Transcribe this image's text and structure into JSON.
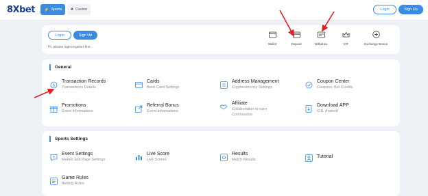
{
  "header": {
    "logo": "8Xbet",
    "tabs": [
      {
        "label": "Sports",
        "icon": "lightning-icon"
      },
      {
        "label": "Casino",
        "icon": "casino-icon"
      }
    ],
    "login_label": "Login",
    "signup_label": "Sign Up"
  },
  "account": {
    "login_label": "Login",
    "signup_label": "Sign Up",
    "hint": "Hi, please login/register first",
    "actions": [
      {
        "label": "Wallet",
        "icon": "wallet-icon"
      },
      {
        "label": "Deposit",
        "icon": "deposit-icon"
      },
      {
        "label": "Withdraw",
        "icon": "withdraw-icon"
      },
      {
        "label": "VIP",
        "icon": "crown-icon"
      },
      {
        "label": "Exchange Bonus",
        "icon": "exchange-icon"
      }
    ]
  },
  "general": {
    "title": "General",
    "items": [
      {
        "title": "Transaction Records",
        "subtitle": "Transactions Details"
      },
      {
        "title": "Cards",
        "subtitle": "Bank Card Settings"
      },
      {
        "title": "Address Management",
        "subtitle": "Cryptocurrency Settings"
      },
      {
        "title": "Coupon Center",
        "subtitle": "Coupons, Bet Credits"
      },
      {
        "title": "Promotions",
        "subtitle": "Event Informations"
      },
      {
        "title": "Referral Bonus",
        "subtitle": "Event Informations"
      },
      {
        "title": "Affiliate",
        "subtitle": "Collaboration to earn",
        "subtitle2": "Commission"
      },
      {
        "title": "Download APP",
        "subtitle": "iOS, Android"
      }
    ]
  },
  "sports": {
    "title": "Sports Settings",
    "items": [
      {
        "title": "Event Settings",
        "subtitle": "Market and Page Settings"
      },
      {
        "title": "Live Score",
        "subtitle": "Live Scores"
      },
      {
        "title": "Results",
        "subtitle": "Match Results"
      },
      {
        "title": "Tutorial",
        "subtitle": ""
      },
      {
        "title": "Game Rules",
        "subtitle": "Betting Rules"
      }
    ]
  },
  "colors": {
    "accent": "#3a8be4",
    "annotation": "#e02020",
    "background": "#eef1f6"
  }
}
